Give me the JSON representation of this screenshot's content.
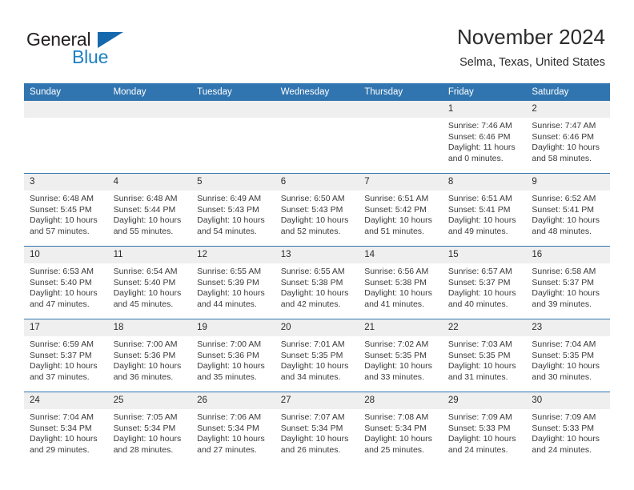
{
  "brand": {
    "name_part1": "General",
    "name_part2": "Blue",
    "accent_color": "#1c7fc4",
    "triangle_color": "#1668ad"
  },
  "header": {
    "title": "November 2024",
    "subtitle": "Selma, Texas, United States"
  },
  "calendar": {
    "header_bg": "#3175b0",
    "daynum_bg": "#efefef",
    "weekdays": [
      "Sunday",
      "Monday",
      "Tuesday",
      "Wednesday",
      "Thursday",
      "Friday",
      "Saturday"
    ],
    "weeks": [
      [
        {
          "day": "",
          "sunrise": "",
          "sunset": "",
          "daylight_line1": "",
          "daylight_line2": ""
        },
        {
          "day": "",
          "sunrise": "",
          "sunset": "",
          "daylight_line1": "",
          "daylight_line2": ""
        },
        {
          "day": "",
          "sunrise": "",
          "sunset": "",
          "daylight_line1": "",
          "daylight_line2": ""
        },
        {
          "day": "",
          "sunrise": "",
          "sunset": "",
          "daylight_line1": "",
          "daylight_line2": ""
        },
        {
          "day": "",
          "sunrise": "",
          "sunset": "",
          "daylight_line1": "",
          "daylight_line2": ""
        },
        {
          "day": "1",
          "sunrise": "Sunrise: 7:46 AM",
          "sunset": "Sunset: 6:46 PM",
          "daylight_line1": "Daylight: 11 hours",
          "daylight_line2": "and 0 minutes."
        },
        {
          "day": "2",
          "sunrise": "Sunrise: 7:47 AM",
          "sunset": "Sunset: 6:46 PM",
          "daylight_line1": "Daylight: 10 hours",
          "daylight_line2": "and 58 minutes."
        }
      ],
      [
        {
          "day": "3",
          "sunrise": "Sunrise: 6:48 AM",
          "sunset": "Sunset: 5:45 PM",
          "daylight_line1": "Daylight: 10 hours",
          "daylight_line2": "and 57 minutes."
        },
        {
          "day": "4",
          "sunrise": "Sunrise: 6:48 AM",
          "sunset": "Sunset: 5:44 PM",
          "daylight_line1": "Daylight: 10 hours",
          "daylight_line2": "and 55 minutes."
        },
        {
          "day": "5",
          "sunrise": "Sunrise: 6:49 AM",
          "sunset": "Sunset: 5:43 PM",
          "daylight_line1": "Daylight: 10 hours",
          "daylight_line2": "and 54 minutes."
        },
        {
          "day": "6",
          "sunrise": "Sunrise: 6:50 AM",
          "sunset": "Sunset: 5:43 PM",
          "daylight_line1": "Daylight: 10 hours",
          "daylight_line2": "and 52 minutes."
        },
        {
          "day": "7",
          "sunrise": "Sunrise: 6:51 AM",
          "sunset": "Sunset: 5:42 PM",
          "daylight_line1": "Daylight: 10 hours",
          "daylight_line2": "and 51 minutes."
        },
        {
          "day": "8",
          "sunrise": "Sunrise: 6:51 AM",
          "sunset": "Sunset: 5:41 PM",
          "daylight_line1": "Daylight: 10 hours",
          "daylight_line2": "and 49 minutes."
        },
        {
          "day": "9",
          "sunrise": "Sunrise: 6:52 AM",
          "sunset": "Sunset: 5:41 PM",
          "daylight_line1": "Daylight: 10 hours",
          "daylight_line2": "and 48 minutes."
        }
      ],
      [
        {
          "day": "10",
          "sunrise": "Sunrise: 6:53 AM",
          "sunset": "Sunset: 5:40 PM",
          "daylight_line1": "Daylight: 10 hours",
          "daylight_line2": "and 47 minutes."
        },
        {
          "day": "11",
          "sunrise": "Sunrise: 6:54 AM",
          "sunset": "Sunset: 5:40 PM",
          "daylight_line1": "Daylight: 10 hours",
          "daylight_line2": "and 45 minutes."
        },
        {
          "day": "12",
          "sunrise": "Sunrise: 6:55 AM",
          "sunset": "Sunset: 5:39 PM",
          "daylight_line1": "Daylight: 10 hours",
          "daylight_line2": "and 44 minutes."
        },
        {
          "day": "13",
          "sunrise": "Sunrise: 6:55 AM",
          "sunset": "Sunset: 5:38 PM",
          "daylight_line1": "Daylight: 10 hours",
          "daylight_line2": "and 42 minutes."
        },
        {
          "day": "14",
          "sunrise": "Sunrise: 6:56 AM",
          "sunset": "Sunset: 5:38 PM",
          "daylight_line1": "Daylight: 10 hours",
          "daylight_line2": "and 41 minutes."
        },
        {
          "day": "15",
          "sunrise": "Sunrise: 6:57 AM",
          "sunset": "Sunset: 5:37 PM",
          "daylight_line1": "Daylight: 10 hours",
          "daylight_line2": "and 40 minutes."
        },
        {
          "day": "16",
          "sunrise": "Sunrise: 6:58 AM",
          "sunset": "Sunset: 5:37 PM",
          "daylight_line1": "Daylight: 10 hours",
          "daylight_line2": "and 39 minutes."
        }
      ],
      [
        {
          "day": "17",
          "sunrise": "Sunrise: 6:59 AM",
          "sunset": "Sunset: 5:37 PM",
          "daylight_line1": "Daylight: 10 hours",
          "daylight_line2": "and 37 minutes."
        },
        {
          "day": "18",
          "sunrise": "Sunrise: 7:00 AM",
          "sunset": "Sunset: 5:36 PM",
          "daylight_line1": "Daylight: 10 hours",
          "daylight_line2": "and 36 minutes."
        },
        {
          "day": "19",
          "sunrise": "Sunrise: 7:00 AM",
          "sunset": "Sunset: 5:36 PM",
          "daylight_line1": "Daylight: 10 hours",
          "daylight_line2": "and 35 minutes."
        },
        {
          "day": "20",
          "sunrise": "Sunrise: 7:01 AM",
          "sunset": "Sunset: 5:35 PM",
          "daylight_line1": "Daylight: 10 hours",
          "daylight_line2": "and 34 minutes."
        },
        {
          "day": "21",
          "sunrise": "Sunrise: 7:02 AM",
          "sunset": "Sunset: 5:35 PM",
          "daylight_line1": "Daylight: 10 hours",
          "daylight_line2": "and 33 minutes."
        },
        {
          "day": "22",
          "sunrise": "Sunrise: 7:03 AM",
          "sunset": "Sunset: 5:35 PM",
          "daylight_line1": "Daylight: 10 hours",
          "daylight_line2": "and 31 minutes."
        },
        {
          "day": "23",
          "sunrise": "Sunrise: 7:04 AM",
          "sunset": "Sunset: 5:35 PM",
          "daylight_line1": "Daylight: 10 hours",
          "daylight_line2": "and 30 minutes."
        }
      ],
      [
        {
          "day": "24",
          "sunrise": "Sunrise: 7:04 AM",
          "sunset": "Sunset: 5:34 PM",
          "daylight_line1": "Daylight: 10 hours",
          "daylight_line2": "and 29 minutes."
        },
        {
          "day": "25",
          "sunrise": "Sunrise: 7:05 AM",
          "sunset": "Sunset: 5:34 PM",
          "daylight_line1": "Daylight: 10 hours",
          "daylight_line2": "and 28 minutes."
        },
        {
          "day": "26",
          "sunrise": "Sunrise: 7:06 AM",
          "sunset": "Sunset: 5:34 PM",
          "daylight_line1": "Daylight: 10 hours",
          "daylight_line2": "and 27 minutes."
        },
        {
          "day": "27",
          "sunrise": "Sunrise: 7:07 AM",
          "sunset": "Sunset: 5:34 PM",
          "daylight_line1": "Daylight: 10 hours",
          "daylight_line2": "and 26 minutes."
        },
        {
          "day": "28",
          "sunrise": "Sunrise: 7:08 AM",
          "sunset": "Sunset: 5:34 PM",
          "daylight_line1": "Daylight: 10 hours",
          "daylight_line2": "and 25 minutes."
        },
        {
          "day": "29",
          "sunrise": "Sunrise: 7:09 AM",
          "sunset": "Sunset: 5:33 PM",
          "daylight_line1": "Daylight: 10 hours",
          "daylight_line2": "and 24 minutes."
        },
        {
          "day": "30",
          "sunrise": "Sunrise: 7:09 AM",
          "sunset": "Sunset: 5:33 PM",
          "daylight_line1": "Daylight: 10 hours",
          "daylight_line2": "and 24 minutes."
        }
      ]
    ]
  }
}
